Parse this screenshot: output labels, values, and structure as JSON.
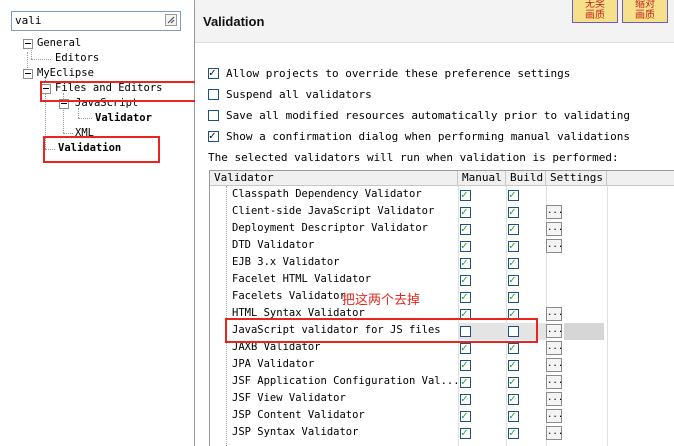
{
  "filter": {
    "value": "vali"
  },
  "tree": {
    "general": "General",
    "editors": "Editors",
    "myeclipse": "MyEclipse",
    "files_and_editors": "Files and Editors",
    "javascript": "JavaScript",
    "validator": "Validator",
    "xml": "XML",
    "validation": "Validation"
  },
  "page": {
    "title": "Validation",
    "badges": [
      "无奖\n画质",
      "缩对\n画质"
    ],
    "options": [
      {
        "label": "Allow projects to override these preference settings",
        "checked": true
      },
      {
        "label": "Suspend all validators",
        "checked": false
      },
      {
        "label": "Save all modified resources automatically prior to validating",
        "checked": false
      },
      {
        "label": "Show a confirmation dialog when performing manual validations",
        "checked": true
      }
    ],
    "note": "The selected validators will run when validation is performed:"
  },
  "table": {
    "columns": [
      "Validator",
      "Manual",
      "Build",
      "Settings"
    ],
    "settings_button_label": "...",
    "rows": [
      {
        "name": "Classpath Dependency Validator",
        "manual": true,
        "build": true,
        "settings": false
      },
      {
        "name": "Client-side JavaScript Validator",
        "manual": true,
        "build": true,
        "settings": true
      },
      {
        "name": "Deployment Descriptor Validator",
        "manual": true,
        "build": true,
        "settings": true
      },
      {
        "name": "DTD Validator",
        "manual": true,
        "build": true,
        "settings": true
      },
      {
        "name": "EJB 3.x Validator",
        "manual": true,
        "build": true,
        "settings": false
      },
      {
        "name": "Facelet HTML Validator",
        "manual": true,
        "build": true,
        "settings": false
      },
      {
        "name": "Facelets Validator",
        "manual": true,
        "build": true,
        "settings": false
      },
      {
        "name": "HTML Syntax Validator",
        "manual": true,
        "build": true,
        "settings": true
      },
      {
        "name": "JavaScript validator for JS files",
        "manual": false,
        "build": false,
        "settings": true
      },
      {
        "name": "JAXB Validator",
        "manual": true,
        "build": true,
        "settings": true
      },
      {
        "name": "JPA Validator",
        "manual": true,
        "build": true,
        "settings": true
      },
      {
        "name": "JSF Application Configuration Val...",
        "manual": true,
        "build": true,
        "settings": true
      },
      {
        "name": "JSF View Validator",
        "manual": true,
        "build": true,
        "settings": true
      },
      {
        "name": "JSP Content Validator",
        "manual": true,
        "build": true,
        "settings": true
      },
      {
        "name": "JSP Syntax Validator",
        "manual": true,
        "build": true,
        "settings": true
      }
    ]
  },
  "annotation": "把这两个去掉",
  "colors": {
    "highlight": "#e8261e",
    "check": "#21a121"
  }
}
